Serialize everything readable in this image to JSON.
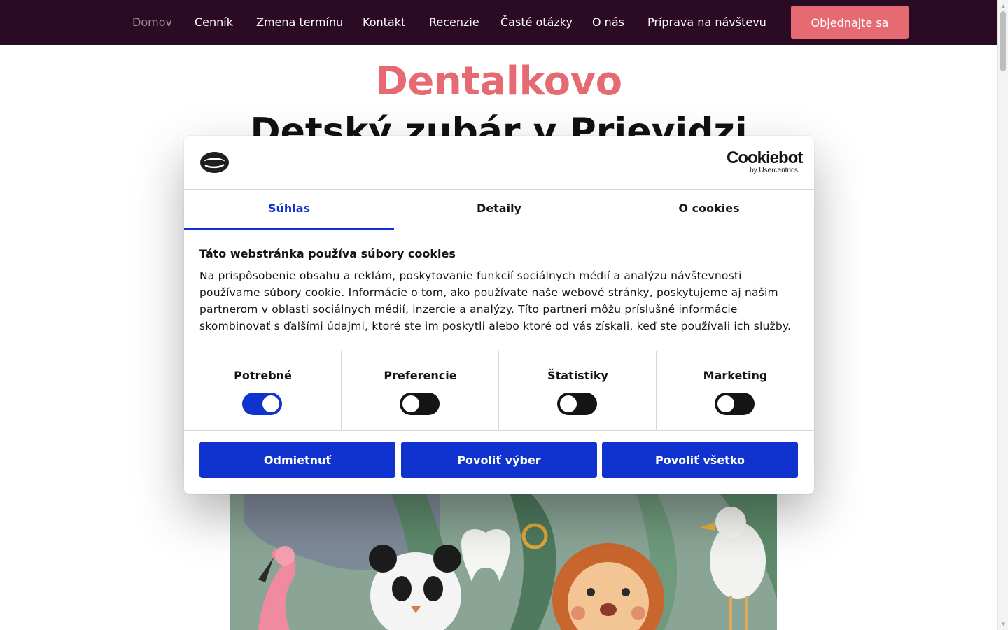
{
  "nav": {
    "items": [
      {
        "label": "Domov"
      },
      {
        "label": "Cenník"
      },
      {
        "label": "Zmena termínu"
      },
      {
        "label": "Kontakt"
      },
      {
        "label": "Recenzie"
      },
      {
        "label": "Časté otázky"
      },
      {
        "label": "O nás"
      },
      {
        "label": "Príprava na návštevu"
      }
    ],
    "active": "Domov",
    "cta": "Objednajte sa"
  },
  "hero": {
    "brand": "Dentalkovo",
    "headline": "Detský zubár v Prievidzi"
  },
  "cookie": {
    "brand": "Cookiebot",
    "brand_sub": "by Usercentrics",
    "tabs": [
      {
        "label": "Súhlas"
      },
      {
        "label": "Detaily"
      },
      {
        "label": "O cookies"
      }
    ],
    "active_tab": "Súhlas",
    "title": "Táto webstránka používa súbory cookies",
    "body": "Na prispôsobenie obsahu a reklám, poskytovanie funkcií sociálnych médií a analýzu návštevnosti používame súbory cookie. Informácie o tom, ako používate naše webové stránky, poskytujeme aj našim partnerom v oblasti sociálnych médií, inzercie a analýzy. Títo partneri môžu príslušné informácie skombinovať s ďalšími údajmi, ktoré ste im poskytli alebo ktoré od vás získali, keď ste používali ich služby.",
    "categories": [
      {
        "label": "Potrebné",
        "enabled": true
      },
      {
        "label": "Preferencie",
        "enabled": false
      },
      {
        "label": "Štatistiky",
        "enabled": false
      },
      {
        "label": "Marketing",
        "enabled": false
      }
    ],
    "buttons": {
      "reject": "Odmietnuť",
      "allow_selection": "Povoliť výber",
      "allow_all": "Povoliť všetko"
    }
  },
  "colors": {
    "nav_bg": "#2b0a23",
    "accent_pink": "#e66a72",
    "cookie_blue": "#1032cf",
    "toggle_off": "#141414"
  }
}
